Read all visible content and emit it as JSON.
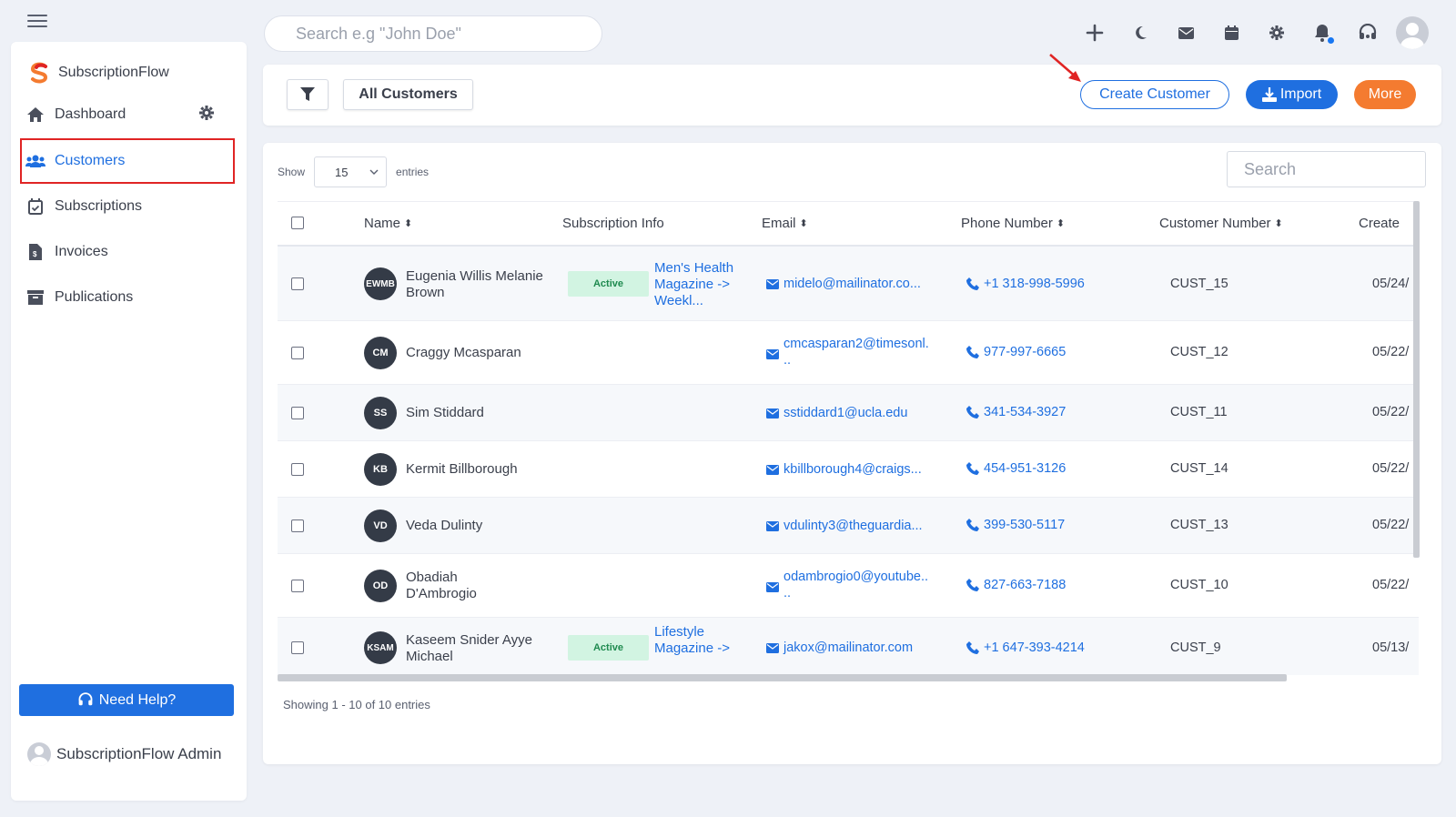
{
  "topbar": {
    "search_placeholder": "Search e.g \"John Doe\"",
    "icons": [
      "plus-icon",
      "moon-icon",
      "mail-icon",
      "calendar-icon",
      "gear-icon",
      "bell-icon",
      "headset-icon",
      "user-avatar"
    ]
  },
  "sidebar": {
    "brand": "SubscriptionFlow",
    "items": [
      {
        "label": "Dashboard",
        "icon": "home-icon"
      },
      {
        "label": "Customers",
        "icon": "users-icon",
        "active": true
      },
      {
        "label": "Subscriptions",
        "icon": "calendar-check-icon"
      },
      {
        "label": "Invoices",
        "icon": "invoice-icon"
      },
      {
        "label": "Publications",
        "icon": "archive-icon"
      }
    ],
    "help_label": "Need Help?",
    "admin_name": "SubscriptionFlow Admin"
  },
  "actions": {
    "view_label": "All Customers",
    "create_label": "Create Customer",
    "import_label": "Import",
    "more_label": "More"
  },
  "table": {
    "show_label": "Show",
    "entries_value": "15",
    "entries_label": "entries",
    "search_placeholder": "Search",
    "columns": [
      "Name",
      "Subscription Info",
      "Email",
      "Phone Number",
      "Customer Number",
      "Create"
    ],
    "rows": [
      {
        "initials": "EWMB",
        "name": "Eugenia Willis Melanie Brown",
        "status": "Active",
        "subscription": "Men's Health Magazine -> Weekl...",
        "email": "midelo@mailinator.co...",
        "phone": "+1 318-998-5996",
        "customer_number": "CUST_15",
        "created": "05/24/"
      },
      {
        "initials": "CM",
        "name": "Craggy Mcasparan",
        "status": "",
        "subscription": "",
        "email": "cmcasparan2@timesonl. ..",
        "phone": "977-997-6665",
        "customer_number": "CUST_12",
        "created": "05/22/"
      },
      {
        "initials": "SS",
        "name": "Sim Stiddard",
        "status": "",
        "subscription": "",
        "email": "sstiddard1@ucla.edu",
        "phone": "341-534-3927",
        "customer_number": "CUST_11",
        "created": "05/22/"
      },
      {
        "initials": "KB",
        "name": "Kermit Billborough",
        "status": "",
        "subscription": "",
        "email": "kbillborough4@craigs...",
        "phone": "454-951-3126",
        "customer_number": "CUST_14",
        "created": "05/22/"
      },
      {
        "initials": "VD",
        "name": "Veda Dulinty",
        "status": "",
        "subscription": "",
        "email": "vdulinty3@theguardia...",
        "phone": "399-530-5117",
        "customer_number": "CUST_13",
        "created": "05/22/"
      },
      {
        "initials": "OD",
        "name": "Obadiah D'Ambrogio",
        "status": "",
        "subscription": "",
        "email": "odambrogio0@youtube.. ..",
        "phone": "827-663-7188",
        "customer_number": "CUST_10",
        "created": "05/22/"
      },
      {
        "initials": "KSAM",
        "name": "Kaseem Snider Ayye Michael",
        "status": "Active",
        "subscription": "Lifestyle Magazine ->",
        "email": "jakox@mailinator.com",
        "phone": "+1 647-393-4214",
        "customer_number": "CUST_9",
        "created": "05/13/"
      }
    ],
    "footer": "Showing 1 - 10 of 10 entries"
  },
  "colors": {
    "primary": "#1f6fe0",
    "more": "#f47b30",
    "active_badge": "#d2f4e2",
    "highlight_box": "#e02424"
  }
}
